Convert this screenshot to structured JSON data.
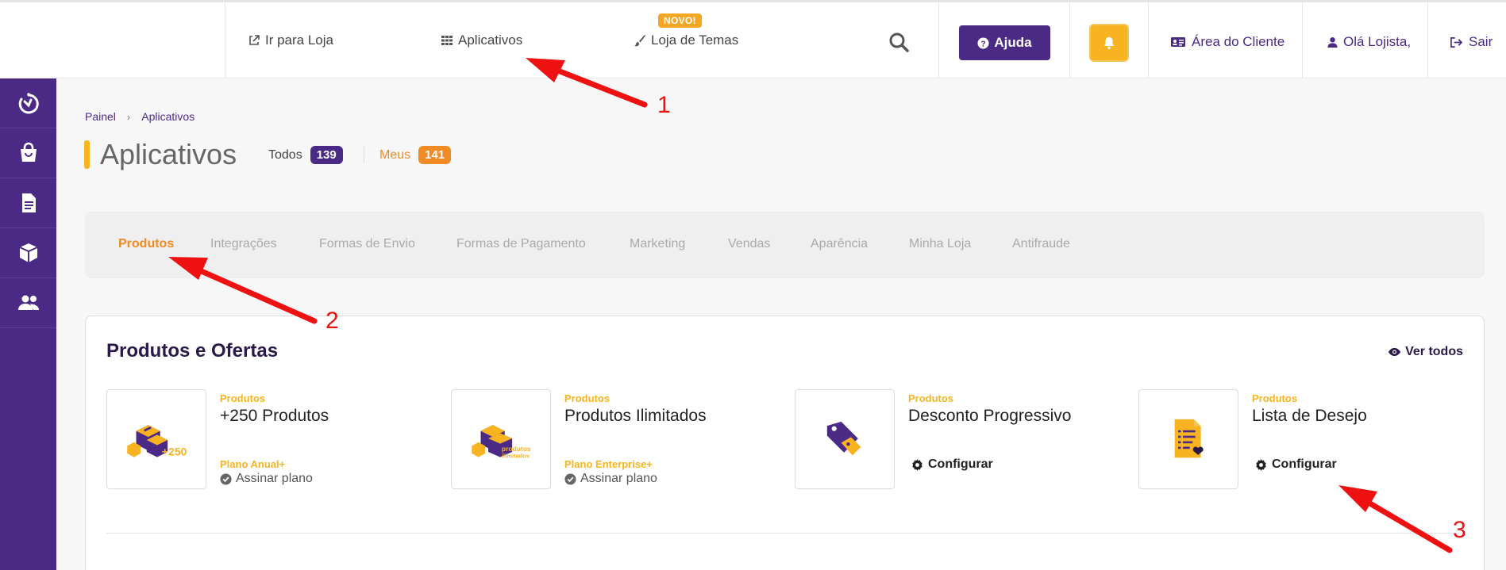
{
  "topbar": {
    "links": {
      "store": "Ir para Loja",
      "apps": "Aplicativos",
      "themes": "Loja de Temas"
    },
    "new_badge": "NOVO!",
    "help_label": "Ajuda",
    "client_area": "Área do Cliente",
    "greeting": "Olá Lojista,",
    "logout": "Sair"
  },
  "sidebar": {
    "items": [
      {
        "icon": "dashboard-icon"
      },
      {
        "icon": "shopping-bag-icon"
      },
      {
        "icon": "document-icon"
      },
      {
        "icon": "box-icon"
      },
      {
        "icon": "users-icon"
      }
    ]
  },
  "breadcrumb": {
    "home": "Painel",
    "current": "Aplicativos"
  },
  "page": {
    "title": "Aplicativos",
    "tabs": [
      {
        "label": "Todos",
        "count": "139",
        "color": "#4b2a86"
      },
      {
        "label": "Meus",
        "count": "141",
        "color": "#f08a24"
      }
    ]
  },
  "categories": [
    "Produtos",
    "Integrações",
    "Formas de Envio",
    "Formas de Pagamento",
    "Marketing",
    "Vendas",
    "Aparência",
    "Minha Loja",
    "Antifraude"
  ],
  "section": {
    "title": "Produtos e Ofertas",
    "view_all": "Ver todos",
    "products": [
      {
        "category": "Produtos",
        "name": "+250 Produtos",
        "plan": "Plano Anual+",
        "action": "Assinar plano",
        "thumb_text": "+250"
      },
      {
        "category": "Produtos",
        "name": "Produtos Ilimitados",
        "plan": "Plano Enterprise+",
        "action": "Assinar plano",
        "thumb_text_1": "produtos",
        "thumb_text_2": "ilimitados"
      },
      {
        "category": "Produtos",
        "name": "Desconto Progressivo",
        "action": "Configurar"
      },
      {
        "category": "Produtos",
        "name": "Lista de Desejo",
        "action": "Configurar"
      }
    ]
  },
  "annotations": [
    "1",
    "2",
    "3"
  ],
  "colors": {
    "brand": "#4b2a86",
    "accent": "#f7b320",
    "active_tab": "#f08a24",
    "annotation": "#ee1111"
  }
}
